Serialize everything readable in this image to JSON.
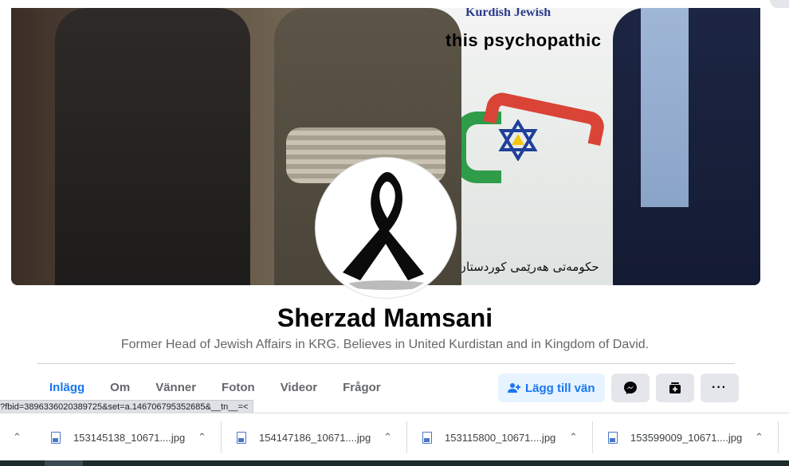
{
  "cover": {
    "caption": "this psychopathic",
    "banner_title": "Kurdish Jewish",
    "banner_arabic": "حکومەتی هەرێمی کوردستان"
  },
  "profile": {
    "name": "Sherzad Mamsani",
    "bio": "Former Head of Jewish Affairs in KRG. Believes in United Kurdistan and in Kingdom of David."
  },
  "tabs": [
    {
      "label": "Inlägg",
      "active": true
    },
    {
      "label": "Om",
      "active": false
    },
    {
      "label": "Vänner",
      "active": false
    },
    {
      "label": "Foton",
      "active": false
    },
    {
      "label": "Videor",
      "active": false
    },
    {
      "label": "Frågor",
      "active": false
    }
  ],
  "actions": {
    "add_friend_label": "Lägg till vän",
    "add_friend_icon": "add-person-icon",
    "messenger_icon": "messenger-icon",
    "follow_icon": "follow-icon",
    "more_label": "···"
  },
  "status_url": "?fbid=3896336020389725&set=a.146706795352685&__tn__=<",
  "downloads": [
    {
      "name": "153145138_10671....jpg"
    },
    {
      "name": "154147186_10671....jpg"
    },
    {
      "name": "153115800_10671....jpg"
    },
    {
      "name": "153599009_10671....jpg"
    }
  ],
  "colors": {
    "accent": "#1877f2",
    "accent_bg": "#e7f3ff",
    "button_bg": "#e4e6eb",
    "secondary_text": "#65676b"
  }
}
